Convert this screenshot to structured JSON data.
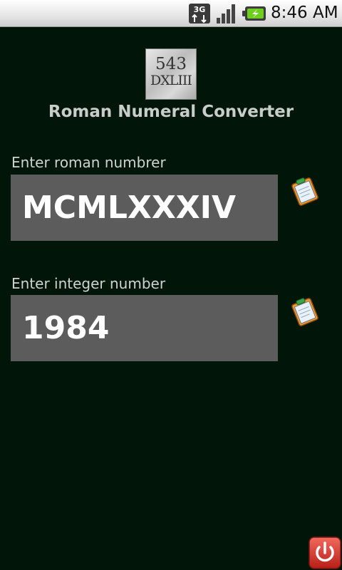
{
  "status_bar": {
    "network_label": "3G",
    "time": "8:46 AM"
  },
  "logo": {
    "number": "543",
    "roman": "DXLIII"
  },
  "app": {
    "title": "Roman Numeral Converter"
  },
  "roman_field": {
    "label": "Enter roman numbrer",
    "value": "MCMLXXXIV"
  },
  "integer_field": {
    "label": "Enter integer number",
    "value": "1984"
  },
  "icons": {
    "paste": "clipboard-icon",
    "exit": "power-icon"
  },
  "colors": {
    "background": "#011608",
    "field_background": "#5c5c5c",
    "title_text": "#c9cdc9",
    "power_button": "#d8302a"
  }
}
